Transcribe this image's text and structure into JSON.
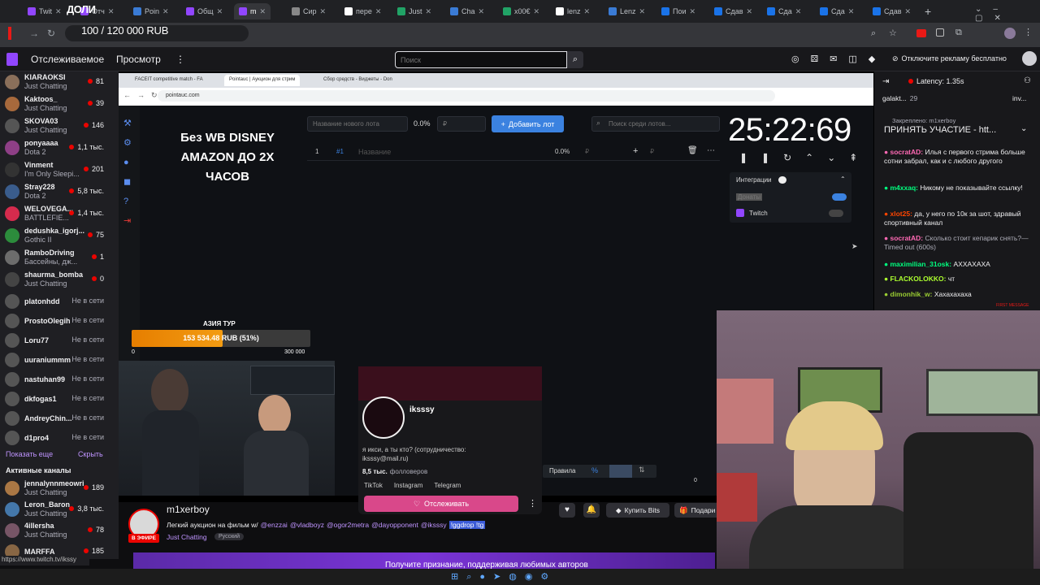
{
  "browser_tabs": [
    {
      "label": "Twit",
      "color": "#9146ff"
    },
    {
      "label": "Отч",
      "color": "#9146ff"
    },
    {
      "label": "Poin",
      "color": "#3a7bd5"
    },
    {
      "label": "Общ",
      "color": "#9146ff"
    },
    {
      "label": "m",
      "color": "#9146ff"
    },
    {
      "label": "Сир",
      "color": "#888888"
    },
    {
      "label": "пере",
      "color": "#ffffff"
    },
    {
      "label": "Just",
      "color": "#21a366"
    },
    {
      "label": "Cha",
      "color": "#3a7bd5"
    },
    {
      "label": "x00€",
      "color": "#21a366"
    },
    {
      "label": "lenz",
      "color": "#ffffff"
    },
    {
      "label": "Lenz",
      "color": "#3a7bd5"
    },
    {
      "label": "Пои",
      "color": "#1a73e8"
    },
    {
      "label": "Сдав",
      "color": "#1a73e8"
    },
    {
      "label": "Сда",
      "color": "#1a73e8"
    },
    {
      "label": "Сда",
      "color": "#1a73e8"
    },
    {
      "label": "Сдав",
      "color": "#1a73e8"
    }
  ],
  "donation_overlay": {
    "brand": "ДОЛИ",
    "progress_text": "100 / 120 000 RUB"
  },
  "twitch_nav": {
    "following": "Отслеживаемое",
    "browse": "Просмотр",
    "search_placeholder": "Поиск",
    "ad_free": "Отключите рекламу бесплатно"
  },
  "sidebar": {
    "channels": [
      {
        "name": "KIARAOKSI",
        "game": "Just Chatting",
        "count": "81",
        "live": true,
        "color": "#8a6f5a"
      },
      {
        "name": "Kaktoos_",
        "game": "Just Chatting",
        "count": "39",
        "live": true,
        "color": "#a7693c"
      },
      {
        "name": "SKOVA03",
        "game": "Just Chatting",
        "count": "146",
        "live": true,
        "color": "#555555"
      },
      {
        "name": "ponyaaaa",
        "game": "Dota 2",
        "count": "1,1 тыс.",
        "live": true,
        "color": "#8e3f86"
      },
      {
        "name": "Vinment",
        "game": "I'm Only Sleepi...",
        "count": "201",
        "live": true,
        "color": "#333333"
      },
      {
        "name": "Stray228",
        "game": "Dota 2",
        "count": "5,8 тыс.",
        "live": true,
        "color": "#3a5c8c"
      },
      {
        "name": "WELOVEGA...",
        "game": "BATTLEFIE...",
        "count": "1,4 тыс.",
        "live": true,
        "color": "#d62b4d"
      },
      {
        "name": "dedushka_igorj...",
        "game": "Gothic II",
        "count": "75",
        "live": true,
        "color": "#2c8c3c"
      },
      {
        "name": "RamboDriving",
        "game": "Бассейны, дж...",
        "count": "1",
        "live": true,
        "color": "#6c6c6c"
      },
      {
        "name": "shaurma_bomba",
        "game": "Just Chatting",
        "count": "0",
        "live": true,
        "color": "#444444"
      },
      {
        "name": "platonhdd",
        "game": "",
        "count": "Не в сети",
        "live": false,
        "color": "#555555"
      },
      {
        "name": "ProstoOlegih",
        "game": "",
        "count": "Не в сети",
        "live": false,
        "color": "#555555"
      },
      {
        "name": "Loru77",
        "game": "",
        "count": "Не в сети",
        "live": false,
        "color": "#555555"
      },
      {
        "name": "uuraniummm",
        "game": "",
        "count": "Не в сети",
        "live": false,
        "color": "#555555"
      },
      {
        "name": "nastuhan99",
        "game": "",
        "count": "Не в сети",
        "live": false,
        "color": "#555555"
      },
      {
        "name": "dkfogas1",
        "game": "",
        "count": "Не в сети",
        "live": false,
        "color": "#555555"
      },
      {
        "name": "AndreyChin...",
        "game": "",
        "count": "Не в сети",
        "live": false,
        "color": "#555555"
      },
      {
        "name": "d1pro4",
        "game": "",
        "count": "Не в сети",
        "live": false,
        "color": "#555555"
      }
    ],
    "show_more": "Показать еще",
    "hide": "Скрыть",
    "active_title": "Активные каналы",
    "active": [
      {
        "name": "jennalynnmeowri",
        "game": "Just Chatting",
        "count": "189",
        "color": "#aa7744"
      },
      {
        "name": "Leron_Baron",
        "game": "Just Chatting",
        "count": "3,8 тыс.",
        "color": "#4477aa"
      },
      {
        "name": "4illersha",
        "game": "Just Chatting",
        "count": "78",
        "color": "#775566"
      },
      {
        "name": "MARFFA",
        "game": "",
        "count": "185",
        "color": "#886644"
      }
    ]
  },
  "inner_browser": {
    "tabs": [
      "FACEIT competitive match - FA",
      "Pointauc | Аукцион для стрим",
      "Сбор средств - Виджеты - Don"
    ],
    "url": "pointauc.com"
  },
  "auction": {
    "side_title": "Без WB DISNEY AMAZON ДО 2Х ЧАСОВ",
    "new_lot_placeholder": "Название нового лота",
    "percent": "0.0%",
    "rub_placeholder": "₽",
    "add_lot": "Добавить лот",
    "search_placeholder": "Поиск среди лотов...",
    "lot_index": "1",
    "lot_hash": "#1",
    "lot_name_placeholder": "Название",
    "lot_percent": "0.0%",
    "lot_rub": "₽",
    "timer": "25:22:69",
    "integrations_label": "Интеграции",
    "donate_label": "Донаты",
    "twitch_label": "Twitch",
    "rules_label": "Правила",
    "rules_symbol": "%",
    "zero": "0"
  },
  "goal": {
    "title": "АЗИЯ ТУР",
    "amount": "153 534.48 RUB (51%)",
    "progress": 0.51,
    "min": "0",
    "max": "300 000"
  },
  "chat": {
    "latency": "Latency: 1.35s",
    "top_user": "galakt...",
    "top_count": "29",
    "top_user2": "inv...",
    "pinned_by": "Закреплено: m1xerboy",
    "pinned_text": "ПРИНЯТЬ УЧАСТИЕ - htt...",
    "messages": [
      {
        "user": "socratAD:",
        "color": "#ff69b4",
        "text": "Илья с первого стрима больше сотни забрал, как и с любого другого"
      },
      {
        "user": "m4xxaq:",
        "color": "#00ff7f",
        "text": "Никому не показывайте ссылку!"
      },
      {
        "user": "xlot25:",
        "color": "#ff4500",
        "text": "да, у него по 10к за шот, здравый спортивный канал"
      },
      {
        "user": "socratAD:",
        "color": "#ff69b4",
        "text": "Сколько стоит кепарик снять?— Timed out (600s)"
      },
      {
        "user": "maximilian_31osk:",
        "color": "#00ff7f",
        "text": "АХХАХАХА"
      },
      {
        "user": "FLACKOLOKKO:",
        "color": "#adff2f",
        "text": "чт"
      },
      {
        "user": "dimonhik_w:",
        "color": "#9acd32",
        "text": "Хахахахаха"
      }
    ],
    "first_message": "FIRST MESSAGE"
  },
  "profile_card": {
    "name": "iksssy",
    "bio": "я икси, а ты кто? (сотрудничество: iksssy@mail.ru)",
    "followers_count": "8,5 тыс.",
    "followers_label": "фолловеров",
    "links": [
      "TikTok",
      "Instagram",
      "Telegram"
    ],
    "follow": "Отслеживать"
  },
  "stream_info": {
    "channel": "m1xerboy",
    "live_badge": "В ЭФИРЕ",
    "title": "Легкий аукцион на фильм w/",
    "mentions": [
      "@enzzai",
      "@vladboyz",
      "@ogor2metra",
      "@dayopponent",
      "@iksssy"
    ],
    "tag_text": "!ggdrop !tg",
    "category": "Just Chatting",
    "language_tag": "Русский",
    "buy_bits": "Купить Bits",
    "gift": "Подари"
  },
  "status_url": "https://www.twitch.tv/ikssy",
  "banner_text": "Получите признание, поддерживая любимых авторов"
}
